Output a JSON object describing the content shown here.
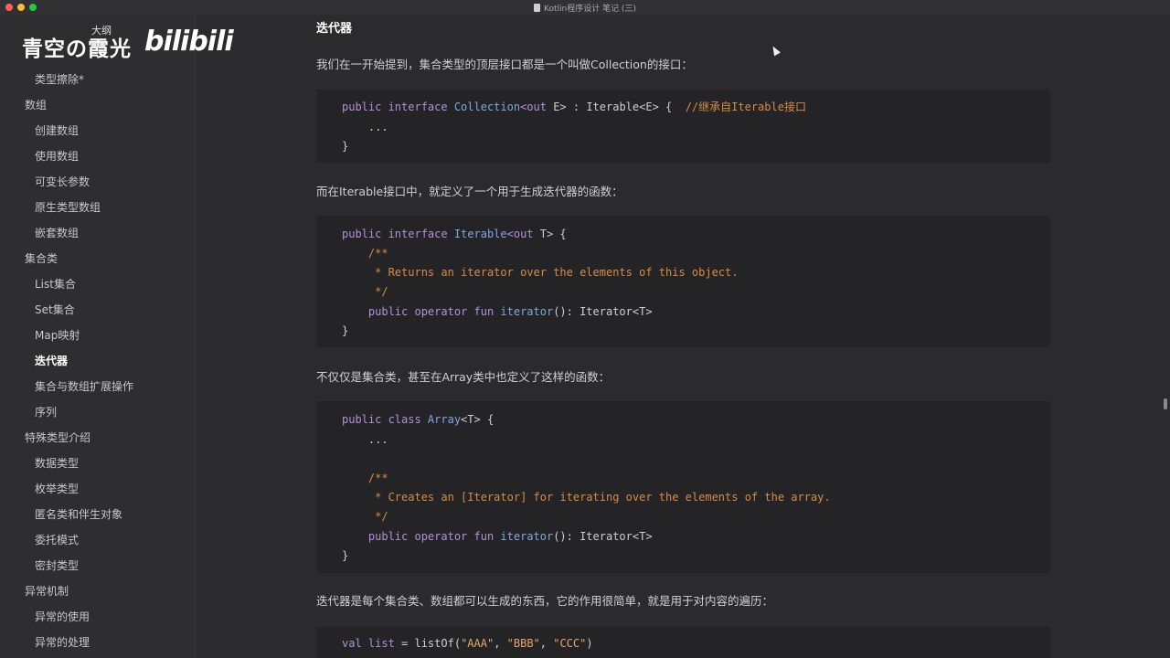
{
  "window": {
    "title": "Kotlin程序设计 笔记 (三)"
  },
  "watermark": {
    "name": "青空の霞光",
    "small": "大纲",
    "logo": "bilibili"
  },
  "sidebar": {
    "items": [
      {
        "label": "类型擦除*",
        "level": 2
      },
      {
        "label": "数组",
        "level": 1
      },
      {
        "label": "创建数组",
        "level": 2
      },
      {
        "label": "使用数组",
        "level": 2
      },
      {
        "label": "可变长参数",
        "level": 2
      },
      {
        "label": "原生类型数组",
        "level": 2
      },
      {
        "label": "嵌套数组",
        "level": 2
      },
      {
        "label": "集合类",
        "level": 1
      },
      {
        "label": "List集合",
        "level": 2
      },
      {
        "label": "Set集合",
        "level": 2
      },
      {
        "label": "Map映射",
        "level": 2
      },
      {
        "label": "迭代器",
        "level": 2,
        "active": true
      },
      {
        "label": "集合与数组扩展操作",
        "level": 2
      },
      {
        "label": "序列",
        "level": 2
      },
      {
        "label": "特殊类型介绍",
        "level": 1
      },
      {
        "label": "数据类型",
        "level": 2
      },
      {
        "label": "枚举类型",
        "level": 2
      },
      {
        "label": "匿名类和伴生对象",
        "level": 2
      },
      {
        "label": "委托模式",
        "level": 2
      },
      {
        "label": "密封类型",
        "level": 2
      },
      {
        "label": "异常机制",
        "level": 1
      },
      {
        "label": "异常的使用",
        "level": 2
      },
      {
        "label": "异常的处理",
        "level": 2
      }
    ]
  },
  "content": {
    "heading": "迭代器",
    "p1": "我们在一开始提到，集合类型的顶层接口都是一个叫做Collection的接口：",
    "p2": "而在Iterable接口中，就定义了一个用于生成迭代器的函数：",
    "p3": "不仅仅是集合类，甚至在Array类中也定义了这样的函数：",
    "p4": "迭代器是每个集合类、数组都可以生成的东西，它的作用很简单，就是用于对内容的遍历：",
    "code1": {
      "l1": {
        "a": "public interface ",
        "b": "Collection",
        "c": "<out ",
        "d": "E> : Iterable<E> {  ",
        "e": "//继承自Iterable接口"
      },
      "l2": "    ...",
      "l3": "}"
    },
    "code2": {
      "l1": {
        "a": "public interface ",
        "b": "Iterable",
        "c": "<out ",
        "d": "T> {"
      },
      "l2": "    /**",
      "l3": "     * Returns an iterator over the elements of this object.",
      "l4": "     */",
      "l5": {
        "a": "    public operator fun ",
        "b": "iterator",
        "c": "(): Iterator<T>"
      },
      "l6": "}"
    },
    "code3": {
      "l1": {
        "a": "public class ",
        "b": "Array",
        "c": "<T> {"
      },
      "l2": "    ...",
      "l4": "    /**",
      "l5": "     * Creates an [Iterator] for iterating over the elements of the array.",
      "l6": "     */",
      "l7": {
        "a": "    public operator fun ",
        "b": "iterator",
        "c": "(): Iterator<T>"
      },
      "l8": "}"
    },
    "code4": {
      "l1": {
        "a": "val ",
        "b": "list",
        "c": " = listOf(",
        "s1": "\"AAA\"",
        "sep1": ", ",
        "s2": "\"BBB\"",
        "sep2": ", ",
        "s3": "\"CCC\"",
        "end": ")"
      }
    }
  },
  "colors": {
    "keyword": "#b490d9",
    "type": "#7fa7e0",
    "comment": "#d78b45",
    "string": "#e6a56b",
    "background": "#2b2b2d"
  }
}
